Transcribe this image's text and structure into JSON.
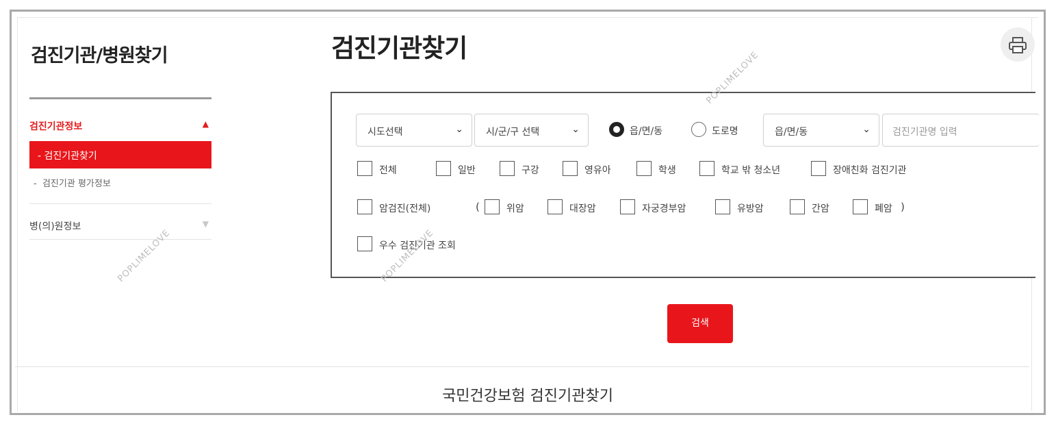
{
  "sidebar": {
    "title": "검진기관/병원찾기",
    "section1": "검진기관정보",
    "active_item": "검진기관찾기",
    "active_prefix": "-",
    "sub_item": "검진기관 평가정보",
    "sub_prefix": "-",
    "section2": "병(의)원정보",
    "arrow_up": "▲",
    "arrow_down": "▼"
  },
  "main": {
    "title": "검진기관찾기",
    "print_icon": "printer-icon"
  },
  "filters": {
    "sido": "시도선택",
    "sigungu": "시/군/구 선택",
    "radio_dong": "읍/면/동",
    "radio_road": "도로명",
    "radio_selected": "읍/면/동",
    "dong_select": "읍/면/동",
    "name_placeholder": "검진기관명 입력",
    "row1": [
      "전체",
      "일반",
      "구강",
      "영유아",
      "학생",
      "학교 밖 청소년",
      "장애친화 검진기관"
    ],
    "cancer_all": "암검진(전체)",
    "paren_open": "(",
    "paren_close": ")",
    "row2": [
      "위암",
      "대장암",
      "자궁경부암",
      "유방암",
      "간암",
      "폐암"
    ],
    "excellent": "우수 검진기관 조회"
  },
  "search_label": "검색",
  "footer": "국민건강보험 검진기관찾기",
  "watermark": "POPLIMELOVE",
  "colors": {
    "accent": "#e8161b",
    "text": "#333333",
    "border": "#555555"
  }
}
